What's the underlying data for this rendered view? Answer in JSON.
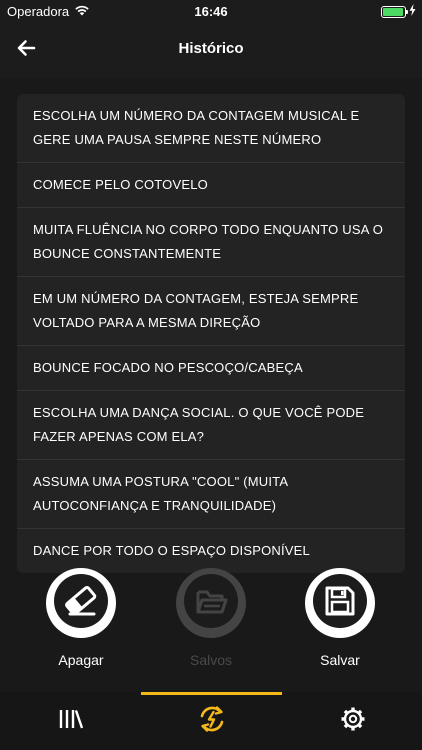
{
  "status_bar": {
    "carrier": "Operadora",
    "time": "16:46",
    "battery_level": 0.95
  },
  "navbar": {
    "title": "Histórico",
    "back_icon": "arrow-left-icon"
  },
  "history": {
    "items": [
      {
        "text": "ESCOLHA UM NÚMERO DA CONTAGEM MUSICAL E GERE UMA PAUSA SEMPRE NESTE NÚMERO"
      },
      {
        "text": "COMECE PELO COTOVELO"
      },
      {
        "text": "MUITA FLUÊNCIA NO CORPO TODO ENQUANTO USA O BOUNCE CONSTANTEMENTE"
      },
      {
        "text": "EM UM NÚMERO DA CONTAGEM, ESTEJA SEMPRE VOLTADO PARA A MESMA DIREÇÃO"
      },
      {
        "text": "BOUNCE FOCADO NO PESCOÇO/CABEÇA"
      },
      {
        "text": "ESCOLHA UMA DANÇA SOCIAL. O QUE VOCÊ PODE FAZER APENAS COM ELA?"
      },
      {
        "text": "ASSUMA UMA POSTURA \"COOL\" (MUITA AUTOCONFIANÇA E TRANQUILIDADE)"
      },
      {
        "text": "DANCE POR TODO O ESPAÇO DISPONÍVEL"
      }
    ]
  },
  "actions": {
    "erase": {
      "label": "Apagar",
      "icon": "eraser-icon"
    },
    "saved": {
      "label": "Salvos",
      "icon": "open-folder-icon",
      "disabled": true
    },
    "save": {
      "label": "Salvar",
      "icon": "floppy-disk-icon"
    }
  },
  "tabbar": {
    "tabs": [
      {
        "icon": "library-icon",
        "active": false
      },
      {
        "icon": "refresh-icon",
        "active": true
      },
      {
        "icon": "gear-icon",
        "active": false
      }
    ],
    "accent_color": "#f5b81b"
  },
  "colors": {
    "background": "#1c1c1c",
    "card": "#232323",
    "accent": "#f5b81b",
    "battery": "#4cd964"
  }
}
